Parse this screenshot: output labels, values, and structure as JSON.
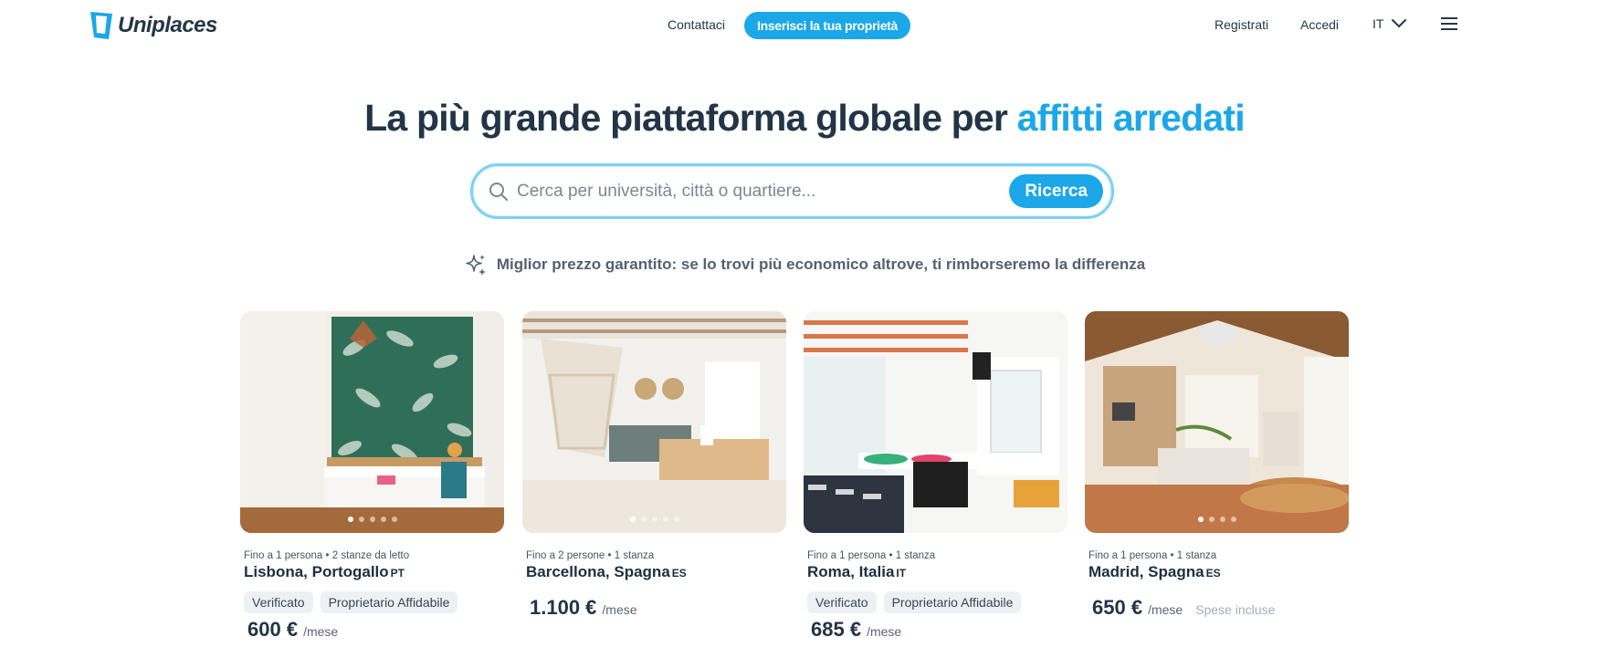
{
  "header": {
    "brand": "Uniplaces",
    "nav_contact": "Contattaci",
    "cta": "Inserisci la tua proprietà",
    "register": "Registrati",
    "login": "Accedi",
    "language": "IT"
  },
  "hero": {
    "title_main": "La più grande piattaforma globale per",
    "title_accent": "affitti arredati",
    "search_placeholder": "Cerca per università, città o quartiere...",
    "search_button": "Ricerca",
    "guarantee": "Miglior prezzo garantito: se lo trovi più economico altrove, ti rimborseremo la differenza"
  },
  "listings": [
    {
      "meta": "Fino a 1 persona • 2 stanze da letto",
      "city": "Lisbona, Portogallo",
      "country_code": "PT",
      "badges": [
        "Verificato",
        "Proprietario Affidabile"
      ],
      "price": "600 €",
      "period": "/mese",
      "extra": ""
    },
    {
      "meta": "Fino a 2 persone • 1 stanza",
      "city": "Barcellona, Spagna",
      "country_code": "ES",
      "badges": [],
      "price": "1.100 €",
      "period": "/mese",
      "extra": ""
    },
    {
      "meta": "Fino a 1 persona • 1 stanza",
      "city": "Roma, Italia",
      "country_code": "IT",
      "badges": [
        "Verificato",
        "Proprietario Affidabile"
      ],
      "price": "685 €",
      "period": "/mese",
      "extra": ""
    },
    {
      "meta": "Fino a 1 persona • 1 stanza",
      "city": "Madrid, Spagna",
      "country_code": "ES",
      "badges": [],
      "price": "650 €",
      "period": "/mese",
      "extra": "Spese incluse"
    }
  ],
  "colors": {
    "accent": "#1ba7e8",
    "heading": "#223547"
  }
}
